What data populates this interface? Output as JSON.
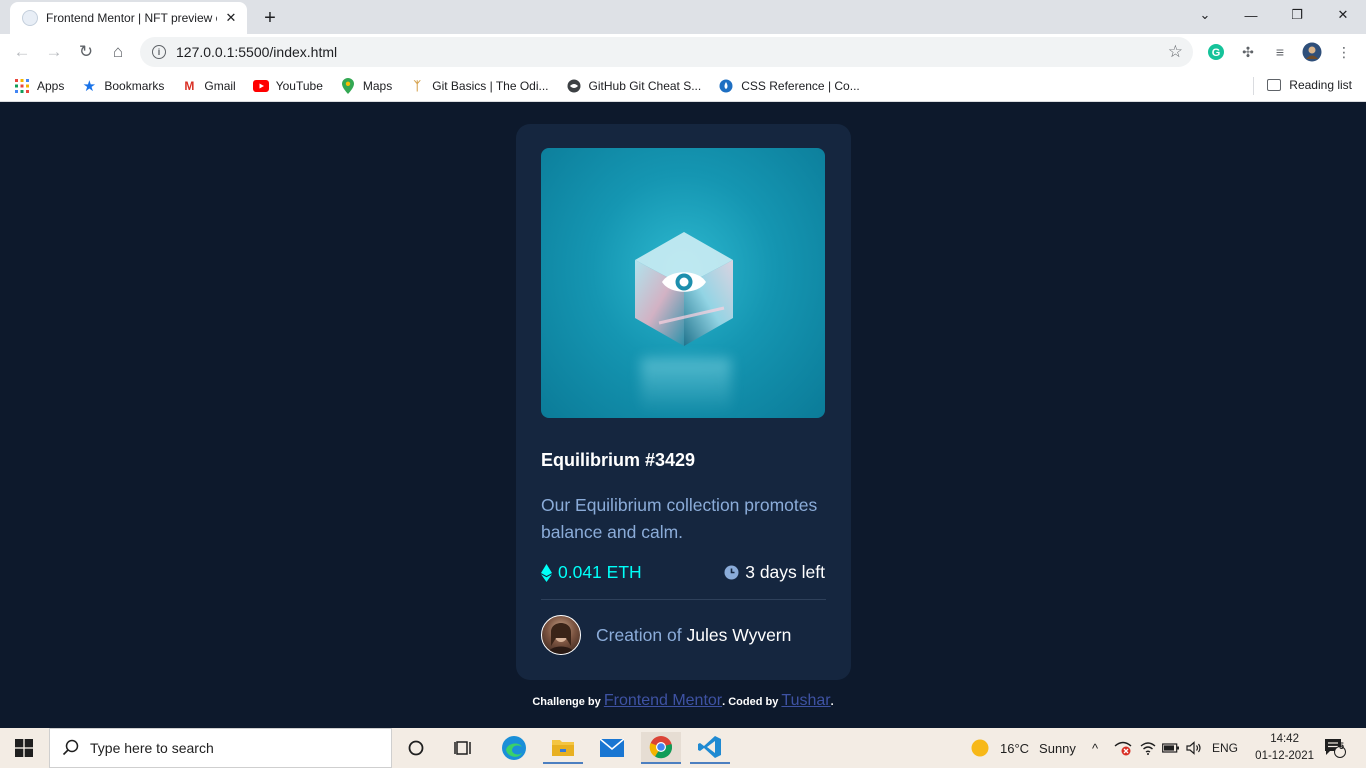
{
  "browser": {
    "tab_title": "Frontend Mentor | NFT preview c",
    "url": "127.0.0.1:5500/index.html",
    "bookmarks": [
      {
        "label": "Apps",
        "icon": "apps-grid-icon"
      },
      {
        "label": "Bookmarks",
        "icon": "star-icon"
      },
      {
        "label": "Gmail",
        "icon": "gmail-icon"
      },
      {
        "label": "YouTube",
        "icon": "youtube-icon"
      },
      {
        "label": "Maps",
        "icon": "maps-pin-icon"
      },
      {
        "label": "Git Basics | The Odi...",
        "icon": "odin-icon"
      },
      {
        "label": "GitHub Git Cheat S...",
        "icon": "github-icon"
      },
      {
        "label": "CSS Reference | Co...",
        "icon": "codrops-icon"
      }
    ],
    "reading_list": "Reading list"
  },
  "card": {
    "title": "Equilibrium #3429",
    "description": "Our Equilibrium collection promotes balance and calm.",
    "price": "0.041 ETH",
    "time_left": "3 days left",
    "creator_prefix": "Creation of",
    "creator_name": "Jules Wyvern"
  },
  "attribution": {
    "prefix": "Challenge by",
    "challenge_link": "Frontend Mentor",
    "middle": ". Coded by",
    "author_link": "Tushar",
    "suffix": "."
  },
  "taskbar": {
    "search_placeholder": "Type here to search",
    "weather_temp": "16°C",
    "weather_text": "Sunny",
    "language": "ENG",
    "time": "14:42",
    "date": "01-12-2021",
    "notification_count": "5"
  },
  "colors": {
    "page_bg": "#0d192c",
    "card_bg": "#15263f",
    "cyan": "#00fff8",
    "soft_blue": "#8bacd9",
    "white": "#ffffff"
  }
}
